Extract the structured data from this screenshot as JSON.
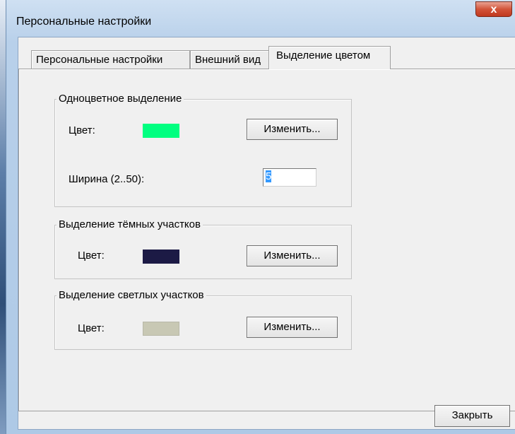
{
  "window": {
    "title": "Персональные настройки",
    "close_label": "x"
  },
  "tabs": [
    {
      "label": "Персональные настройки",
      "active": false
    },
    {
      "label": "Внешний вид",
      "active": false
    },
    {
      "label": "Выделение цветом",
      "active": true
    }
  ],
  "groups": {
    "single": {
      "caption": "Одноцветное выделение",
      "color_label": "Цвет:",
      "color": "#00ff80",
      "change_label": "Изменить...",
      "width_label": "Ширина (2..50):",
      "width_value": "5"
    },
    "dark": {
      "caption": "Выделение тёмных участков",
      "color_label": "Цвет:",
      "color": "#1c1a45",
      "change_label": "Изменить..."
    },
    "light": {
      "caption": "Выделение светлых участков",
      "color_label": "Цвет:",
      "color": "#c8c8b4",
      "change_label": "Изменить..."
    }
  },
  "footer": {
    "close_button": "Закрыть"
  }
}
